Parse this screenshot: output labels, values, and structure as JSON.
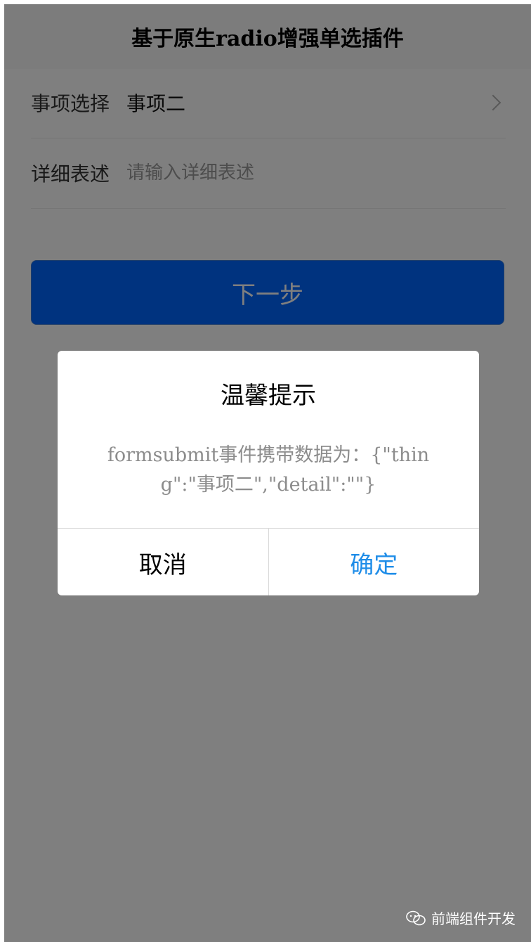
{
  "navbar": {
    "title": "基于原生radio增强单选插件"
  },
  "form": {
    "item_select": {
      "label": "事项选择",
      "value": "事项二",
      "icon": "chevron-right-icon"
    },
    "detail": {
      "label": "详细表述",
      "placeholder": "请输入详细表述",
      "value": ""
    },
    "next_button": {
      "label": "下一步"
    }
  },
  "dialog": {
    "title": "温馨提示",
    "content": "formsubmit事件携带数据为：{\"thing\":\"事项二\",\"detail\":\"\"}",
    "cancel_label": "取消",
    "confirm_label": "确定"
  },
  "watermark": {
    "icon": "wechat-icon",
    "text": "前端组件开发"
  },
  "colors": {
    "primary_button": "#0066ff",
    "confirm_text": "#1f8de8",
    "mask": "rgba(0,0,0,0.5)"
  }
}
